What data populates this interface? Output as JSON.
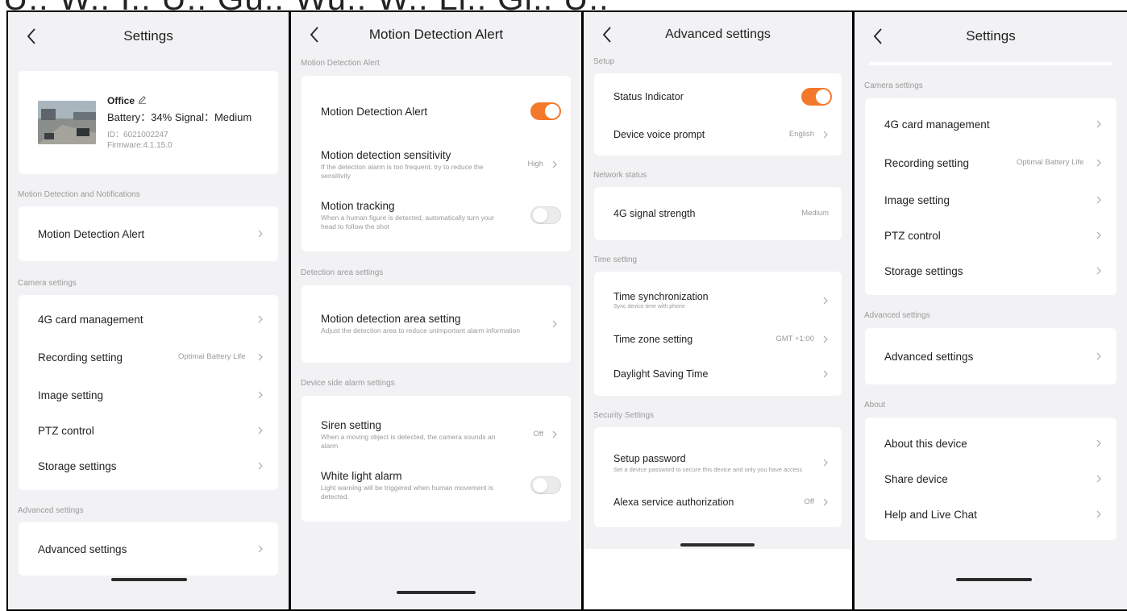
{
  "caption": "U.. W.. I.. U.. Gu.. Wu.. W.. Li.. Gi.. U..",
  "screen1": {
    "title": "Settings",
    "device": {
      "name": "Office",
      "battery_line": "Battery：34% Signal：Medium",
      "id_line": "ID：6021002247",
      "firmware_line": "Firmware:4.1.15.0"
    },
    "section_motion": "Motion Detection and Notifications",
    "motion_item": "Motion Detection Alert",
    "section_camera": "Camera settings",
    "camera_items": [
      {
        "label": "4G card management",
        "value": ""
      },
      {
        "label": "Recording setting",
        "value": "Optimal Battery Life"
      },
      {
        "label": "Image setting",
        "value": ""
      },
      {
        "label": "PTZ control",
        "value": ""
      },
      {
        "label": "Storage settings",
        "value": ""
      }
    ],
    "section_advanced": "Advanced settings",
    "advanced_item": "Advanced settings"
  },
  "screen2": {
    "title": "Motion Detection Alert",
    "section_main": "Motion Detection Alert",
    "alert_label": "Motion Detection Alert",
    "alert_on": true,
    "sensitivity_label": "Motion detection sensitivity",
    "sensitivity_sub": "If the detection alarm is too frequent, try to reduce the sensitivity",
    "sensitivity_value": "High",
    "tracking_label": "Motion tracking",
    "tracking_sub": "When a human figure is detected, automatically turn your head to follow the shot",
    "tracking_on": false,
    "section_area": "Detection area settings",
    "area_label": "Motion detection area setting",
    "area_sub": "Adjust the detection area to reduce unimportant alarm information",
    "section_alarm": "Device side alarm settings",
    "siren_label": "Siren setting",
    "siren_sub": "When a moving object is detected, the camera sounds an alarm",
    "siren_value": "Off",
    "light_label": "White light alarm",
    "light_sub": "Light warning will be triggered when human movement is detected.",
    "light_on": false
  },
  "screen3": {
    "title": "Advanced settings",
    "section_setup": "Setup",
    "status_label": "Status Indicator",
    "status_on": true,
    "voice_label": "Device voice prompt",
    "voice_value": "English",
    "section_network": "Network status",
    "signal_label": "4G signal strength",
    "signal_value": "Medium",
    "section_time": "Time setting",
    "sync_label": "Time synchronization",
    "sync_sub": "Sync device time with phone",
    "zone_label": "Time zone setting",
    "zone_value": "GMT +1:00",
    "dst_label": "Daylight Saving Time",
    "section_security": "Security Settings",
    "password_label": "Setup password",
    "password_sub": "Set a device password to secure this device and only you have access",
    "alexa_label": "Alexa service authorization",
    "alexa_value": "Off"
  },
  "screen4": {
    "title": "Settings",
    "section_camera": "Camera settings",
    "camera_items": [
      {
        "label": "4G card management",
        "value": ""
      },
      {
        "label": "Recording setting",
        "value": "Optimal Battery Life"
      },
      {
        "label": "Image setting",
        "value": ""
      },
      {
        "label": "PTZ control",
        "value": ""
      },
      {
        "label": "Storage settings",
        "value": ""
      }
    ],
    "section_advanced": "Advanced settings",
    "advanced_item": "Advanced settings",
    "section_about": "About",
    "about_items": [
      "About this device",
      "Share device",
      "Help and Live Chat"
    ]
  },
  "colors": {
    "accent": "#f4782a",
    "background": "#f2f2f4",
    "card": "#ffffff",
    "muted": "#9a9a9a"
  },
  "icons": [
    "back-chevron-icon",
    "chevron-right-icon",
    "edit-pencil-icon",
    "toggle-switch"
  ]
}
